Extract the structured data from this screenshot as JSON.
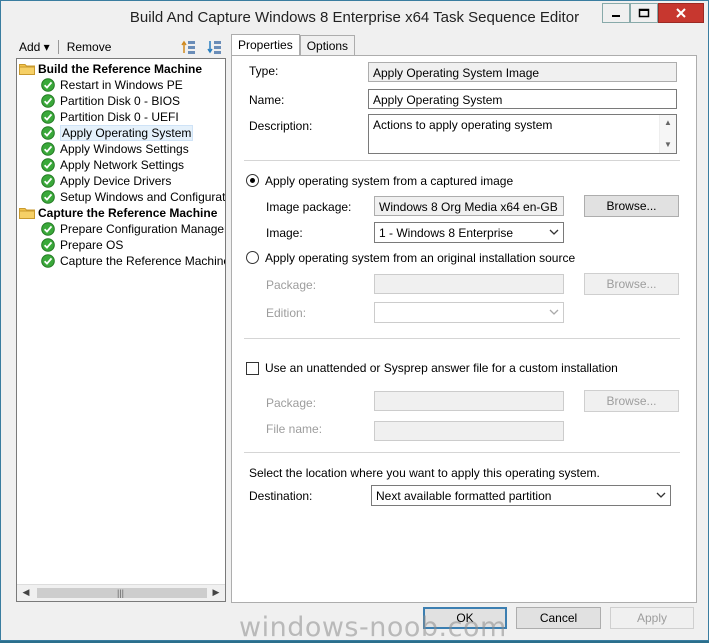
{
  "window": {
    "title": "Build And Capture Windows 8 Enterprise x64 Task Sequence Editor",
    "controls": {
      "minimize_icon": "minimize-icon",
      "maximize_icon": "maximize-icon",
      "close_icon": "close-icon"
    }
  },
  "toolbar": {
    "add_label": "Add ▾",
    "remove_label": "Remove"
  },
  "tree": {
    "groups": [
      {
        "label": "Build the Reference Machine",
        "items": [
          {
            "label": "Restart in Windows PE"
          },
          {
            "label": "Partition Disk 0 - BIOS"
          },
          {
            "label": "Partition Disk 0 - UEFI"
          },
          {
            "label": "Apply Operating System",
            "selected": true
          },
          {
            "label": "Apply Windows Settings"
          },
          {
            "label": "Apply Network Settings"
          },
          {
            "label": "Apply Device Drivers"
          },
          {
            "label": "Setup Windows and Configuration"
          }
        ]
      },
      {
        "label": "Capture the Reference Machine",
        "items": [
          {
            "label": "Prepare Configuration Manager Cli"
          },
          {
            "label": "Prepare OS"
          },
          {
            "label": "Capture the Reference Machine"
          }
        ]
      }
    ]
  },
  "tabs": [
    {
      "label": "Properties",
      "active": true
    },
    {
      "label": "Options",
      "active": false
    }
  ],
  "properties": {
    "type_label": "Type:",
    "type_value": "Apply Operating System Image",
    "name_label": "Name:",
    "name_value": "Apply Operating System",
    "description_label": "Description:",
    "description_value": "Actions to apply operating system",
    "radio_captured_label": "Apply operating system from a captured image",
    "image_package_label": "Image package:",
    "image_package_value": "Windows 8 Org Media x64 en-GB",
    "browse_label": "Browse...",
    "image_label": "Image:",
    "image_value": "1 - Windows 8 Enterprise",
    "radio_original_label": "Apply operating system from an original installation source",
    "package_label": "Package:",
    "edition_label": "Edition:",
    "unattend_label": "Use an unattended or Sysprep answer file for a custom installation",
    "package2_label": "Package:",
    "filename_label": "File name:",
    "location_text": "Select the location where you want to apply this operating system.",
    "destination_label": "Destination:",
    "destination_value": "Next available formatted partition"
  },
  "buttons": {
    "ok": "OK",
    "cancel": "Cancel",
    "apply": "Apply"
  },
  "watermark": "windows-noob.com"
}
